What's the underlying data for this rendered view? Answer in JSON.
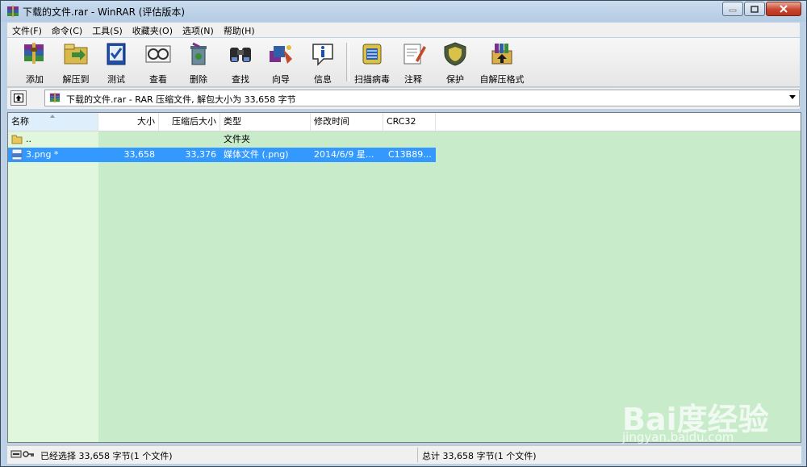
{
  "window": {
    "title": "下载的文件.rar - WinRAR (评估版本)"
  },
  "menu": [
    "文件(F)",
    "命令(C)",
    "工具(S)",
    "收藏夹(O)",
    "选项(N)",
    "帮助(H)"
  ],
  "toolbar": [
    {
      "label": "添加",
      "icon": "add-archive-icon"
    },
    {
      "label": "解压到",
      "icon": "extract-to-icon"
    },
    {
      "label": "测试",
      "icon": "test-icon"
    },
    {
      "label": "查看",
      "icon": "view-icon"
    },
    {
      "label": "删除",
      "icon": "delete-icon"
    },
    {
      "label": "查找",
      "icon": "find-icon"
    },
    {
      "label": "向导",
      "icon": "wizard-icon"
    },
    {
      "label": "信息",
      "icon": "info-icon"
    },
    {
      "label": "扫描病毒",
      "icon": "scan-virus-icon"
    },
    {
      "label": "注释",
      "icon": "comment-icon"
    },
    {
      "label": "保护",
      "icon": "protect-icon"
    },
    {
      "label": "自解压格式",
      "icon": "sfx-icon"
    }
  ],
  "address": {
    "text": "下载的文件.rar - RAR 压缩文件, 解包大小为 33,658 字节"
  },
  "columns": [
    "名称",
    "大小",
    "压缩后大小",
    "类型",
    "修改时间",
    "CRC32"
  ],
  "files": [
    {
      "name": "..",
      "size": "",
      "packed": "",
      "type": "文件夹",
      "modified": "",
      "crc": "",
      "icon": "folder-icon",
      "selected": false
    },
    {
      "name": "3.png *",
      "size": "33,658",
      "packed": "33,376",
      "type": "媒体文件 (.png)",
      "modified": "2014/6/9 星...",
      "crc": "C13B89...",
      "icon": "png-file-icon",
      "selected": true
    }
  ],
  "status": {
    "left": "已经选择 33,658 字节(1 个文件)",
    "right": "总计 33,658 字节(1 个文件)"
  },
  "watermark": {
    "brand": "Bai度经验",
    "url": "jingyan.baidu.com"
  }
}
